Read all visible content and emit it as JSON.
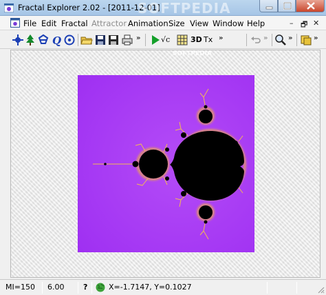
{
  "window": {
    "title": "Fractal Explorer 2.02  - [2011-12-01]",
    "watermark": "SOFTPEDIA"
  },
  "menu": {
    "items": [
      {
        "label": "File",
        "enabled": true
      },
      {
        "label": "Edit",
        "enabled": true
      },
      {
        "label": "Fractal",
        "enabled": true
      },
      {
        "label": "Attractor",
        "enabled": false
      },
      {
        "label": "Animation",
        "enabled": true
      },
      {
        "label": "Size",
        "enabled": true
      },
      {
        "label": "View",
        "enabled": true
      },
      {
        "label": "Window",
        "enabled": true
      },
      {
        "label": "Help",
        "enabled": true
      }
    ]
  },
  "toolbar": {
    "sqrt_label": "√c",
    "three_d_label": "3D",
    "tx_label": "Tx",
    "chevron": "»"
  },
  "status": {
    "ml": "MI=150",
    "zoom": "6.00",
    "help": "?",
    "coords": "X=-1.7147, Y=0.1027"
  },
  "colors": {
    "fractal_background": "#a033f5",
    "set_color": "#000000",
    "fringe_color": "#f5b43a"
  },
  "icons": [
    "app-icon",
    "document-icon",
    "minimize-icon",
    "restore-icon",
    "close-icon",
    "crosshair-icon",
    "tree-icon",
    "recycle-icon",
    "q-icon",
    "target-icon",
    "open-folder-icon",
    "save-icon",
    "save-as-icon",
    "print-icon",
    "play-icon",
    "grid-icon",
    "undo-icon",
    "zoom-icon",
    "palette-icon",
    "globe-icon"
  ]
}
